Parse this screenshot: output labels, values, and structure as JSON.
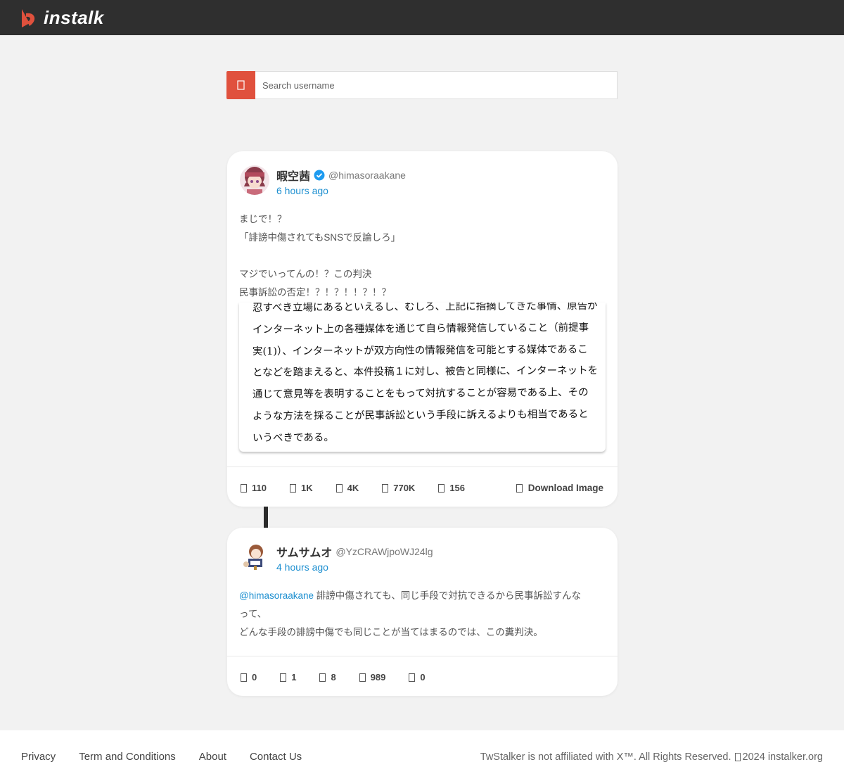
{
  "app": {
    "logo_text": "instalk",
    "brand_color": "#e0513d"
  },
  "search": {
    "placeholder": "Search username",
    "icon": "search-icon"
  },
  "posts": [
    {
      "display_name": "暇空茜",
      "verified": true,
      "handle": "@himasoraakane",
      "time": "6 hours ago",
      "text_lines": [
        "まじで！？",
        "「誹謗中傷されてもSNSで反論しろ」",
        "",
        "マジでいってんの！？この判決",
        "民事訴訟の否定！？！？！！？！？"
      ],
      "image_text_lines": [
        "忍すべき立場にあるといえるし、むしろ、上記に指摘してきた事情、原告が",
        "インターネット上の各種媒体を通じて自ら情報発信していること（前提事",
        "実(1)）、インターネットが双方向性の情報発信を可能とする媒体であるこ",
        "となどを踏まえると、本件投稿１に対し、被告と同様に、インターネットを",
        "通じて意見等を表明することをもって対抗することが容易である上、その",
        "ような方法を採ることが民事訴訟という手段に訴えるよりも相当であると",
        "いうべきである。"
      ],
      "stats": [
        {
          "icon": "comment-icon",
          "value": "110"
        },
        {
          "icon": "quote-icon",
          "value": "1K"
        },
        {
          "icon": "retweet-icon",
          "value": "4K"
        },
        {
          "icon": "view-icon",
          "value": "770K"
        },
        {
          "icon": "bookmark-icon",
          "value": "156"
        }
      ],
      "download_label": "Download Image"
    },
    {
      "display_name": "サムサムオ",
      "verified": false,
      "handle": "@YzCRAWjpoWJ24lg",
      "time": "4 hours ago",
      "mention": "@himasoraakane",
      "text_line1_rest": " 誹謗中傷されても、同じ手段で対抗できるから民事訴訟すんな",
      "text_line2": "って、",
      "text_line3": "どんな手段の誹謗中傷でも同じことが当てはまるのでは、この糞判決。",
      "stats": [
        {
          "icon": "comment-icon",
          "value": "0"
        },
        {
          "icon": "quote-icon",
          "value": "1"
        },
        {
          "icon": "retweet-icon",
          "value": "8"
        },
        {
          "icon": "view-icon",
          "value": "989"
        },
        {
          "icon": "bookmark-icon",
          "value": "0"
        }
      ]
    }
  ],
  "footer": {
    "links": [
      "Privacy",
      "Term and Conditions",
      "About",
      "Contact Us"
    ],
    "copyright_prefix": "TwStalker is not affiliated with X™. All Rights Reserved.",
    "copyright_suffix": "2024 instalker.org"
  }
}
